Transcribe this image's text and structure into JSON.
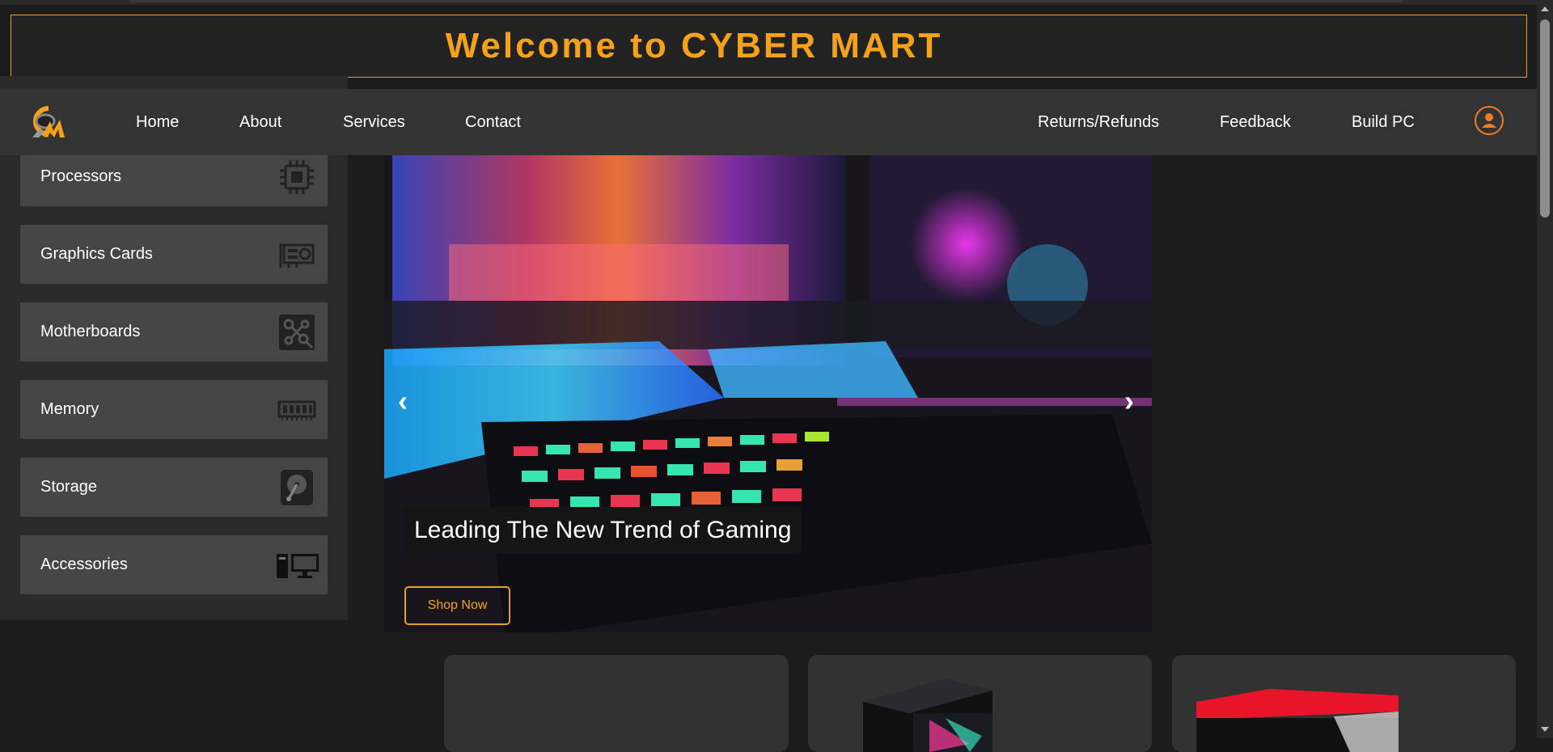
{
  "banner": {
    "title": "Welcome to CYBER MART"
  },
  "nav": {
    "left": [
      "Home",
      "About",
      "Services",
      "Contact"
    ],
    "right": [
      "Returns/Refunds",
      "Feedback",
      "Build PC"
    ],
    "logo_icon": "cyber-mart-logo",
    "profile_icon": "user-icon"
  },
  "sidebar": {
    "categories": [
      {
        "label": "Processors",
        "icon": "cpu-icon"
      },
      {
        "label": "Graphics Cards",
        "icon": "gpu-icon"
      },
      {
        "label": "Motherboards",
        "icon": "motherboard-icon"
      },
      {
        "label": "Memory",
        "icon": "memory-icon"
      },
      {
        "label": "Storage",
        "icon": "hard-drive-icon"
      },
      {
        "label": "Accessories",
        "icon": "desktop-icon"
      }
    ]
  },
  "hero": {
    "caption": "Leading The New Trend of Gaming",
    "prev_arrow": "‹",
    "next_arrow": "›",
    "cta": "Shop Now"
  },
  "colors": {
    "accent": "#f5a21a",
    "avatar_ring": "#f07d2a",
    "background": "#1c1c1c",
    "panel": "#454545"
  }
}
